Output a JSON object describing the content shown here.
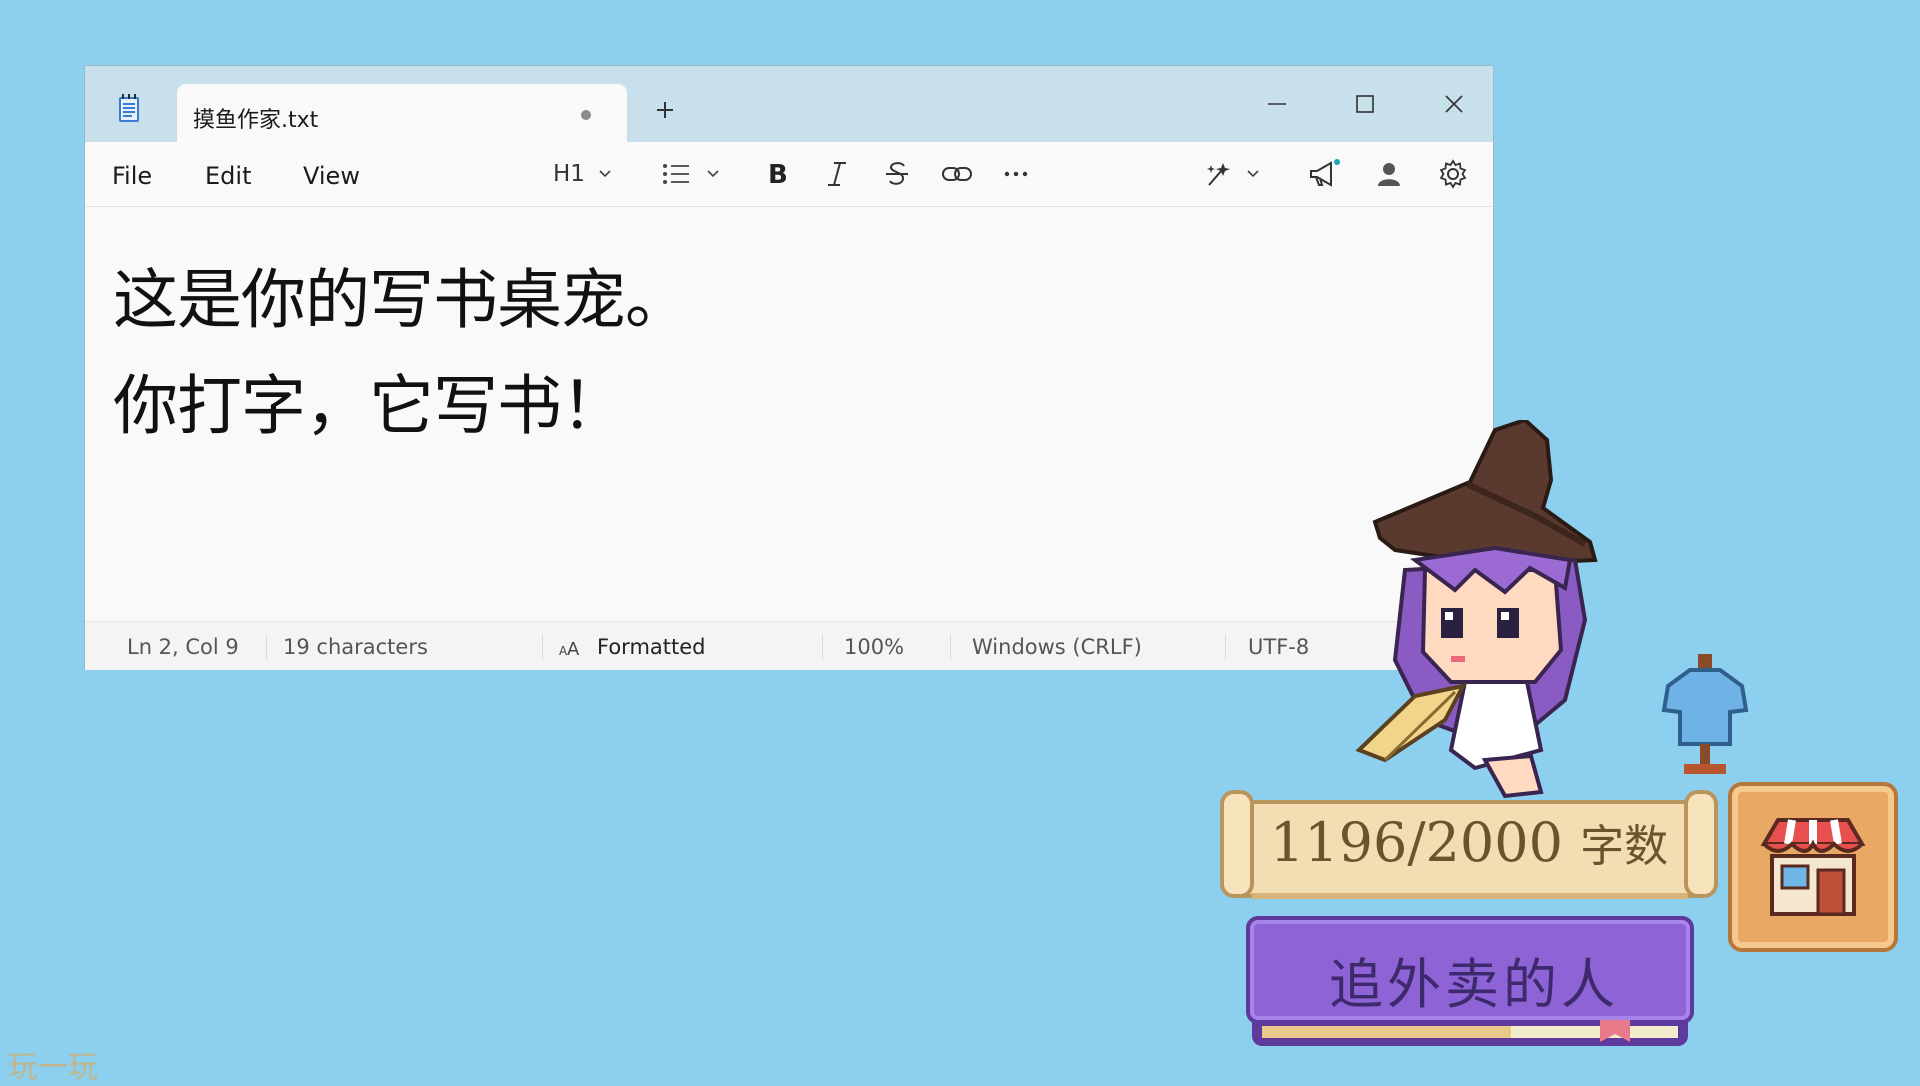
{
  "window": {
    "tab_title": "摸鱼作家.txt",
    "app_icon": "notepad-icon",
    "controls": [
      "minimize-icon",
      "maximize-icon",
      "close-icon"
    ]
  },
  "menu": {
    "file": "File",
    "edit": "Edit",
    "view": "View"
  },
  "toolbar": {
    "heading": "H1",
    "icons": [
      "list-icon",
      "bold-icon",
      "italic-icon",
      "strikethrough-icon",
      "link-icon",
      "more-icon",
      "copilot-icon",
      "megaphone-icon",
      "account-icon",
      "gear-icon"
    ]
  },
  "document": {
    "lines": [
      "这是你的写书桌宠。",
      "你打字，它写书！"
    ]
  },
  "status": {
    "position": "Ln 2, Col 9",
    "characters": "19 characters",
    "format": "Formatted",
    "zoom": "100%",
    "line_ending": "Windows (CRLF)",
    "encoding": "UTF-8"
  },
  "pet": {
    "word_count": "1196/2000",
    "word_unit": "字数",
    "book_title": "追外卖的人",
    "progress_fraction": 0.598
  },
  "watermark": "玩一玩",
  "colors": {
    "background": "#8dcfee",
    "titlebar": "#c7e0ec",
    "book": "#8e63d6",
    "scroll": "#f3ddb2"
  }
}
